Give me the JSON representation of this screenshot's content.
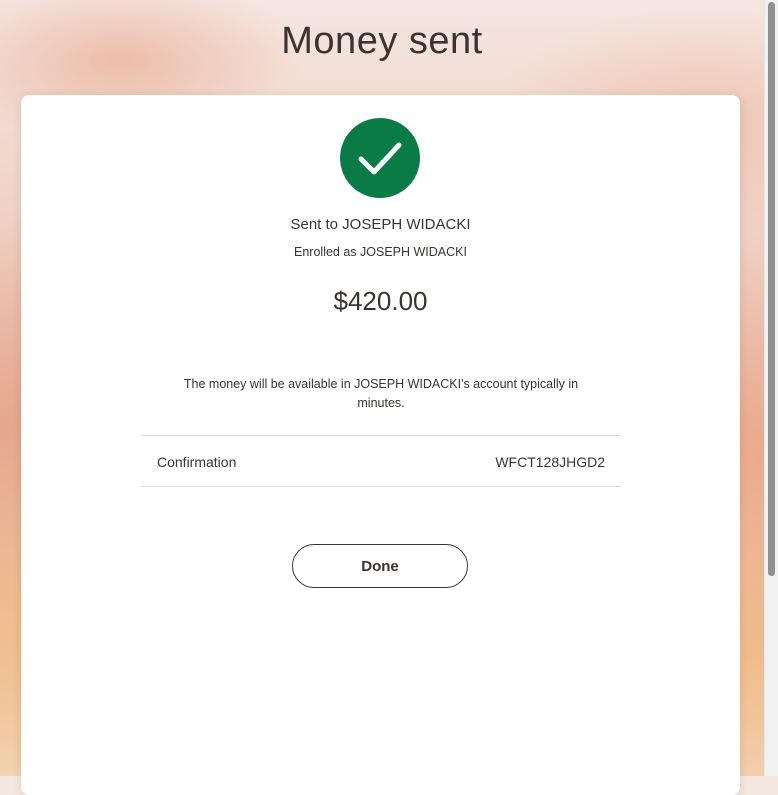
{
  "page": {
    "title": "Money sent"
  },
  "confirmation_card": {
    "status_icon": "checkmark-icon",
    "sent_to": "Sent to JOSEPH WIDACKI",
    "enrolled_as": "Enrolled as JOSEPH WIDACKI",
    "amount": "$420.00",
    "availability_message": "The money will be available in JOSEPH WIDACKI's account typically in minutes.",
    "confirmation_label": "Confirmation",
    "confirmation_number": "WFCT128JHGD2",
    "done_label": "Done"
  },
  "colors": {
    "success_green": "#0a7a47",
    "text": "#3b3331",
    "card_background": "#ffffff"
  }
}
